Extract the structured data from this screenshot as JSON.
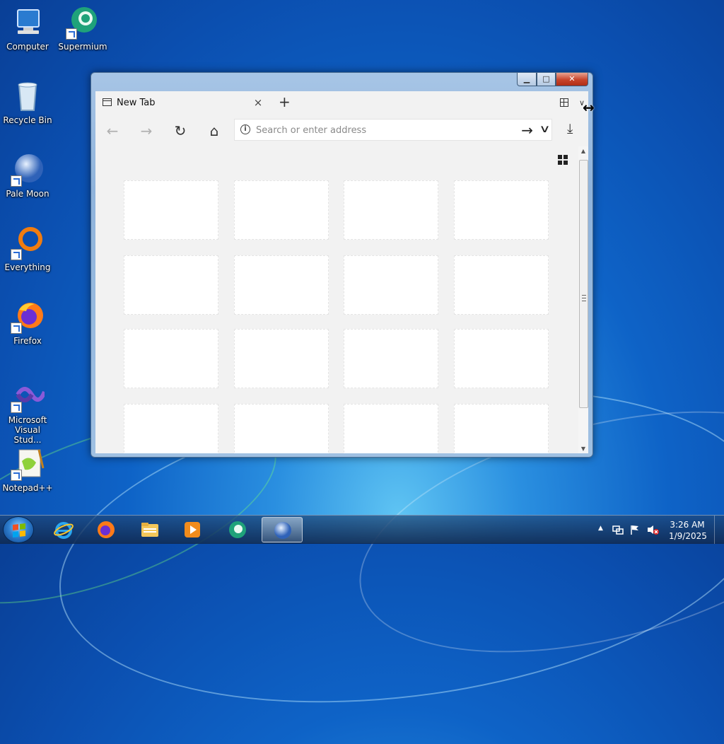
{
  "desktop": {
    "icons": [
      {
        "label": "Computer",
        "icon": "computer-icon"
      },
      {
        "label": "Supermium",
        "icon": "supermium-icon"
      },
      {
        "label": "Recycle Bin",
        "icon": "recycle-bin-icon"
      },
      {
        "label": "Pale Moon",
        "icon": "pale-moon-icon"
      },
      {
        "label": "Everything",
        "icon": "everything-icon"
      },
      {
        "label": "Firefox",
        "icon": "firefox-icon"
      },
      {
        "label": "Microsoft Visual Studio...",
        "line1": "Microsoft",
        "line2": "Visual Stud...",
        "icon": "visual-studio-icon"
      },
      {
        "label": "Notepad++",
        "icon": "notepad-plus-plus-icon"
      }
    ]
  },
  "window": {
    "tab_title": "New Tab",
    "tab_close": "×",
    "new_tab": "+",
    "address_placeholder": "Search or enter address",
    "info_glyph": "i",
    "go_glyph": "→",
    "dropdown_glyph": "∨",
    "back_glyph": "←",
    "forward_glyph": "→",
    "reload_glyph": "↻",
    "home_glyph": "⌂",
    "download_glyph": "⤓",
    "min_glyph": "▁",
    "max_glyph": "□",
    "close_glyph": "✕",
    "speed_dial_rows": 4,
    "speed_dial_cols": 4
  },
  "taskbar": {
    "pinned": [
      "internet-explorer-icon",
      "firefox-icon",
      "file-explorer-icon",
      "media-player-icon",
      "supermium-icon",
      "pale-moon-icon"
    ],
    "active": "pale-moon-icon",
    "clock_time": "3:26 AM",
    "clock_date": "1/9/2025",
    "tray_up": "▲",
    "colors": {
      "accent": "#0e63c7"
    }
  }
}
